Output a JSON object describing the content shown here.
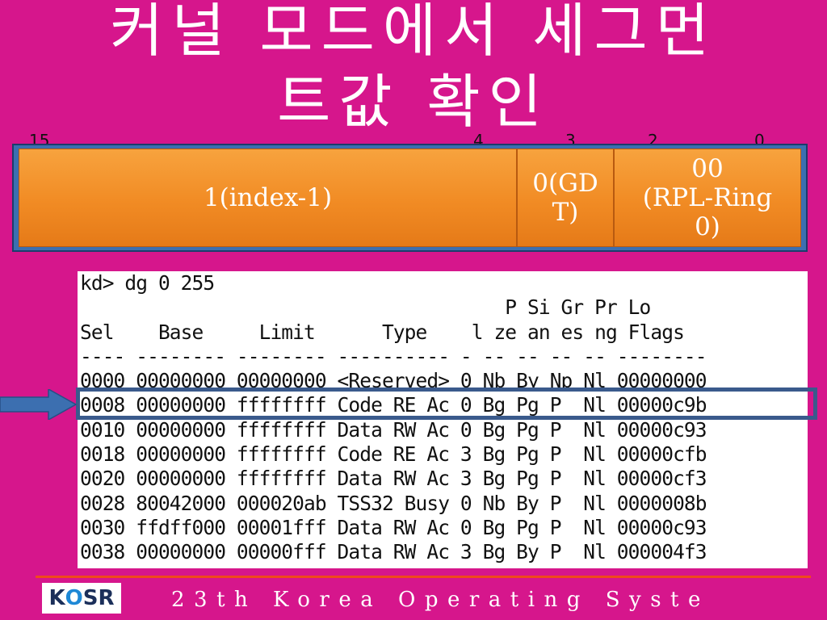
{
  "title": {
    "line1": "커널 모드에서 세그먼",
    "line2": "트값 확인"
  },
  "bit_labels": [
    "15",
    "4",
    "3",
    "2",
    "0"
  ],
  "selector": {
    "index": "1(index-1)",
    "ti_line1": "0(GD",
    "ti_line2": "T)",
    "rpl_line1": "00",
    "rpl_line2": "(RPL-Ring",
    "rpl_line3": "0)"
  },
  "terminal": {
    "command": "kd> dg 0 255",
    "header1": "                                      P Si Gr Pr Lo",
    "header2": "Sel    Base     Limit      Type    l ze an es ng Flags",
    "separator": "---- -------- -------- ---------- - -- -- -- -- --------",
    "rows": [
      "0000 00000000 00000000 <Reserved> 0 Nb By Np Nl 00000000",
      "0008 00000000 ffffffff Code RE Ac 0 Bg Pg P  Nl 00000c9b",
      "0010 00000000 ffffffff Data RW Ac 0 Bg Pg P  Nl 00000c93",
      "0018 00000000 ffffffff Code RE Ac 3 Bg Pg P  Nl 00000cfb",
      "0020 00000000 ffffffff Data RW Ac 3 Bg Pg P  Nl 00000cf3",
      "0028 80042000 000020ab TSS32 Busy 0 Nb By P  Nl 0000008b",
      "0030 ffdff000 00001fff Data RW Ac 0 Bg Pg P  Nl 00000c93",
      "0038 00000000 00000fff Data RW Ac 3 Bg By P  Nl 000004f3"
    ]
  },
  "footer": {
    "logo_k": "K",
    "logo_o": "O",
    "logo_sr": "SR",
    "text": "23th Korea Operating Syste"
  },
  "colors": {
    "background": "#d6168c",
    "segment": "#f18b24",
    "frame": "#3c6fb0",
    "highlight": "#3a5a8c",
    "footer_line": "#ef4a1c"
  }
}
